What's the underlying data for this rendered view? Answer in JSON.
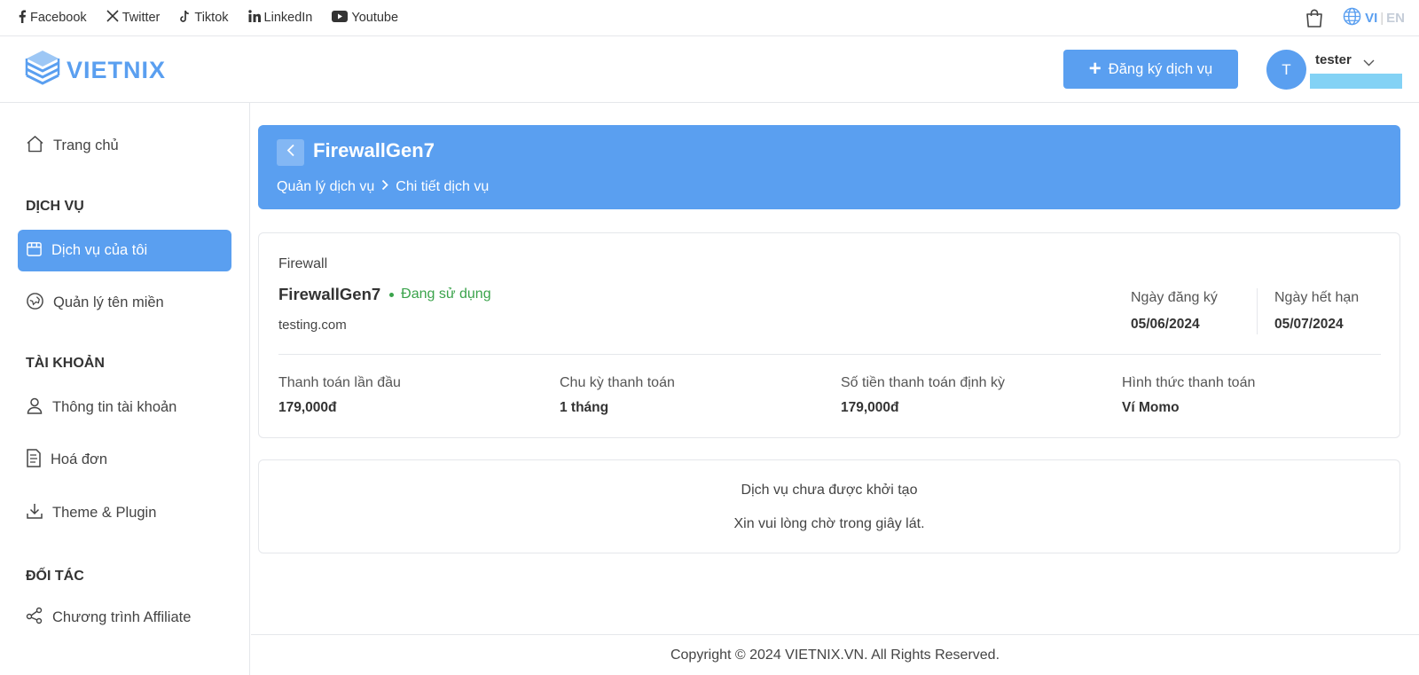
{
  "social": {
    "items": [
      {
        "label": "Facebook",
        "icon": "facebook-icon"
      },
      {
        "label": "Twitter",
        "icon": "x-twitter-icon"
      },
      {
        "label": "Tiktok",
        "icon": "tiktok-icon"
      },
      {
        "label": "LinkedIn",
        "icon": "linkedin-icon"
      },
      {
        "label": "Youtube",
        "icon": "youtube-icon"
      }
    ]
  },
  "lang": {
    "vi": "VI",
    "sep": "|",
    "en": "EN"
  },
  "header": {
    "logo_text": "VIETNIX",
    "register_label": "Đăng ký dịch vụ",
    "register_icon": "+",
    "user": {
      "initial": "T",
      "name": "tester"
    }
  },
  "sidebar": {
    "home": "Trang chủ",
    "section_services": "DỊCH VỤ",
    "my_services": "Dịch vụ của tôi",
    "domains": "Quản lý tên miền",
    "section_account": "TÀI KHOẢN",
    "account_info": "Thông tin tài khoản",
    "invoices": "Hoá đơn",
    "themes": "Theme & Plugin",
    "section_partners": "ĐỐI TÁC",
    "affiliate": "Chương trình Affiliate"
  },
  "hero": {
    "title": "FirewallGen7",
    "breadcrumb": [
      "Quản lý dịch vụ",
      "Chi tiết dịch vụ"
    ]
  },
  "service": {
    "type": "Firewall",
    "name": "FirewallGen7",
    "status": "Đang sử dụng",
    "domain": "testing.com",
    "register_date_label": "Ngày đăng ký",
    "register_date": "05/06/2024",
    "expire_date_label": "Ngày hết hạn",
    "expire_date": "05/07/2024",
    "info": [
      {
        "label": "Thanh toán lần đầu",
        "value": "179,000đ"
      },
      {
        "label": "Chu kỳ thanh toán",
        "value": "1 tháng"
      },
      {
        "label": "Số tiền thanh toán định kỳ",
        "value": "179,000đ"
      },
      {
        "label": "Hình thức thanh toán",
        "value": "Ví Momo"
      }
    ]
  },
  "notice": {
    "line1": "Dịch vụ chưa được khởi tạo",
    "line2": "Xin vui lòng chờ trong giây lát."
  },
  "footer": {
    "copyright": "Copyright © 2024 VIETNIX.VN. All Rights Reserved."
  },
  "colors": {
    "accent": "#5a9ff0",
    "status_green": "#3aa34b",
    "email_mask": "#83d2f5"
  }
}
